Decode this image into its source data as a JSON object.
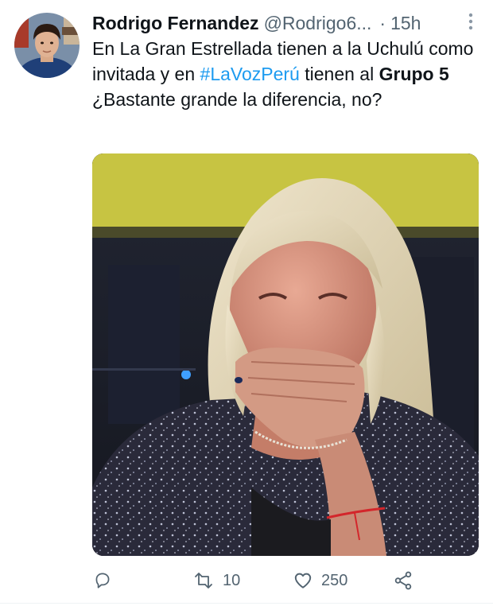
{
  "tweet": {
    "author": {
      "display_name": "Rodrigo Fernandez",
      "handle": "@Rodrigo6...",
      "separator": "·",
      "time": "15h"
    },
    "text": {
      "part1": "En La Gran Estrellada tienen a la Uchulú como invitada y en ",
      "hashtag": "#LaVozPerú",
      "part2": " tienen al ",
      "bold": "Grupo 5",
      "part3": " ¿Bastante grande la diferencia, no?"
    },
    "actions": {
      "retweet_count": "10",
      "like_count": "250"
    },
    "icons": {
      "more": "more-icon",
      "reply": "reply-icon",
      "retweet": "retweet-icon",
      "like": "heart-icon",
      "share": "share-icon"
    },
    "colors": {
      "link": "#1d9bf0",
      "secondary_text": "#536471",
      "primary_text": "#0f1419"
    }
  }
}
